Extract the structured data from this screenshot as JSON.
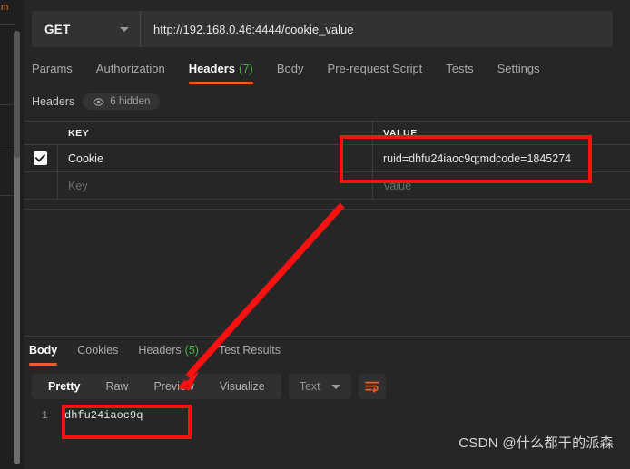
{
  "request": {
    "method": "GET",
    "method_caret_icon": "chevron-down-icon",
    "url": "http://192.168.0.46:4444/cookie_value",
    "tabs": [
      {
        "label": "Params",
        "count": "",
        "active": false
      },
      {
        "label": "Authorization",
        "count": "",
        "active": false
      },
      {
        "label": "Headers",
        "count": "(7)",
        "active": true
      },
      {
        "label": "Body",
        "count": "",
        "active": false
      },
      {
        "label": "Pre-request Script",
        "count": "",
        "active": false
      },
      {
        "label": "Tests",
        "count": "",
        "active": false
      },
      {
        "label": "Settings",
        "count": "",
        "active": false
      }
    ]
  },
  "headers_section": {
    "label": "Headers",
    "hidden_pill": {
      "icon": "eye-icon",
      "label": "6 hidden"
    },
    "columns": [
      "KEY",
      "VALUE"
    ],
    "rows": [
      {
        "checked": true,
        "key": "Cookie",
        "value": "ruid=dhfu24iaoc9q;mdcode=1845274",
        "is_placeholder": false
      },
      {
        "checked": false,
        "key": "Key",
        "value": "Value",
        "is_placeholder": true
      }
    ]
  },
  "response": {
    "tabs": [
      {
        "label": "Body",
        "count": "",
        "active": true
      },
      {
        "label": "Cookies",
        "count": "",
        "active": false
      },
      {
        "label": "Headers",
        "count": "(5)",
        "active": false
      },
      {
        "label": "Test Results",
        "count": "",
        "active": false
      }
    ],
    "format_buttons": [
      {
        "label": "Pretty",
        "active": true
      },
      {
        "label": "Raw",
        "active": false
      },
      {
        "label": "Preview",
        "active": false
      },
      {
        "label": "Visualize",
        "active": false
      }
    ],
    "type_select": {
      "value": "Text",
      "caret_icon": "chevron-down-icon"
    },
    "wrap_button_icon": "wrap-text-icon",
    "body": {
      "line_number": "1",
      "content": "dhfu24iaoc9q"
    }
  },
  "annotations": {
    "highlight_color": "#fc1010",
    "arrow_color": "#fc1010"
  },
  "watermark": "CSDN @什么都干的派森",
  "colors": {
    "accent": "#ef5b25",
    "count_green": "#4caf50",
    "background": "#262626",
    "panel": "#323232"
  }
}
